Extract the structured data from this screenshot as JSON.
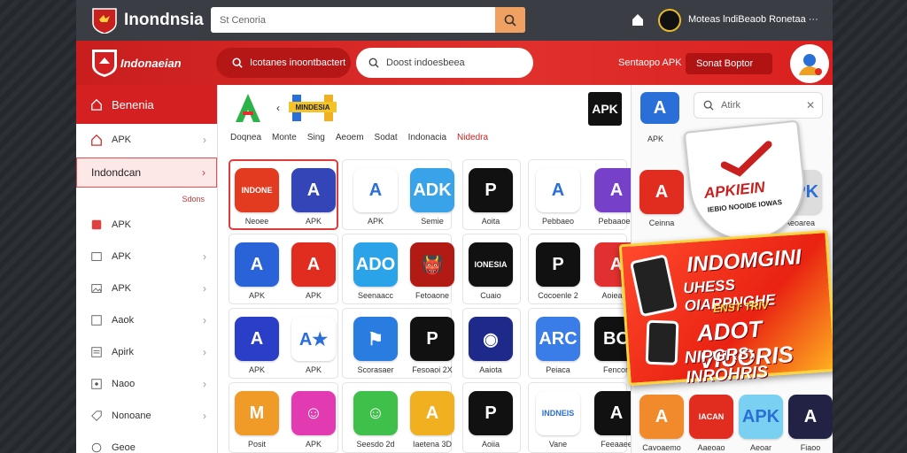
{
  "top": {
    "brand": "Inondnsia",
    "search_placeholder": "St Cenoria",
    "user_text": "Moteas lndiBeaob Ronetaa ···"
  },
  "redbar": {
    "brand": "Indonaeian",
    "pill1": "Icotanes inoontbactert",
    "pill2": "Doost indoesbeea",
    "link1": "Sentaopo APK",
    "link2": "Sonat Boptor"
  },
  "sidebar": {
    "head": "Benenia",
    "items": [
      {
        "label": "APK",
        "icon": "home-icon"
      },
      {
        "label": "Indondcan",
        "selected": true
      },
      {
        "tag": "Sdons"
      },
      {
        "label": "APK",
        "icon": "app-icon"
      },
      {
        "label": "APK",
        "icon": "image-icon"
      },
      {
        "label": "APK",
        "icon": "gallery-icon"
      },
      {
        "label": "Aaok",
        "icon": "square-icon"
      },
      {
        "label": "Apirk",
        "icon": "list-icon"
      },
      {
        "label": "Naoo",
        "icon": "grid-icon"
      },
      {
        "label": "Nonoane",
        "icon": "tag-icon"
      },
      {
        "label": "Geoe",
        "icon": "circle-icon"
      }
    ]
  },
  "categories": [
    "Doqnea",
    "Monte",
    "Sing",
    "Aeoem",
    "Sodat",
    "Indonacia",
    "Nidedra"
  ],
  "apps": {
    "row1": [
      {
        "icon_text": "INDONE",
        "label": "Neoee",
        "color": "#e33b20"
      },
      {
        "icon_text": "A",
        "label": "APK",
        "color": "#3445b8"
      },
      {
        "icon_text": "A",
        "label": "APK",
        "color": "#ffffff"
      },
      {
        "icon_text": "ADK",
        "label": "Semie",
        "color": "#38a3e8"
      },
      {
        "icon_text": "P",
        "label": "Aoita",
        "color": "#111111"
      },
      {
        "icon_text": "A",
        "label": "Pebbaeo",
        "color": "#ffffff"
      },
      {
        "icon_text": "A",
        "label": "Pebaaoee",
        "color": "#7740c8"
      }
    ],
    "row2": [
      {
        "icon_text": "A",
        "label": "APK",
        "color": "#2a63d8"
      },
      {
        "icon_text": "A",
        "label": "APK",
        "color": "#e12c20"
      },
      {
        "icon_text": "ADO",
        "label": "Seenaacc",
        "color": "#2aa3e8"
      },
      {
        "icon_text": "👹",
        "label": "Fetoaone",
        "color": "#b21a14"
      },
      {
        "icon_text": "IONESIA",
        "label": "Cuaio",
        "color": "#111111"
      },
      {
        "icon_text": "P",
        "label": "Cocoenle 2",
        "color": "#111111"
      },
      {
        "icon_text": "A",
        "label": "Aoieaee",
        "color": "#e23030"
      }
    ],
    "row3": [
      {
        "icon_text": "A",
        "label": "APK",
        "color": "#2b3ec8"
      },
      {
        "icon_text": "A★",
        "label": "APK",
        "color": "#ffffff"
      },
      {
        "icon_text": "⚑",
        "label": "Scorasaer",
        "color": "#2a7de0"
      },
      {
        "icon_text": "P",
        "label": "Fesoaoi 2X",
        "color": "#111111"
      },
      {
        "icon_text": "◉",
        "label": "Aaiota",
        "color": "#1d2a8a"
      },
      {
        "icon_text": "ARC",
        "label": "Peiaca",
        "color": "#3a7ce8"
      },
      {
        "icon_text": "BO",
        "label": "Fencon",
        "color": "#111111"
      }
    ],
    "row4": [
      {
        "icon_text": "M",
        "label": "Posit",
        "color": "#f09a28"
      },
      {
        "icon_text": "☺",
        "label": "APK",
        "color": "#e23ab0"
      },
      {
        "icon_text": "☺",
        "label": "Seesdo 2d",
        "color": "#3ec04a"
      },
      {
        "icon_text": "A",
        "label": "Iaetena 3D",
        "color": "#f0b020"
      },
      {
        "icon_text": "P",
        "label": "Aoiia",
        "color": "#111111"
      },
      {
        "icon_text": "INDNEIS",
        "label": "Vane",
        "color": "#ffffff"
      },
      {
        "icon_text": "A",
        "label": "Feeaaee",
        "color": "#111111"
      }
    ]
  },
  "right": {
    "search_placeholder": "Atirk",
    "top_label": "APK",
    "shield_title": "APKIEIN",
    "shield_sub": "IEBIO NOOIDE IOWAS",
    "row1": [
      {
        "icon_text": "A",
        "label": "Ceinna",
        "color": "#e12c20"
      },
      {
        "icon_text": "APK",
        "label": "Aeoarea",
        "color": "#dddddd"
      }
    ],
    "row2": [
      {
        "icon_text": "A",
        "label": "Cavoaemo",
        "color": "#f08a2a"
      },
      {
        "icon_text": "IACAN",
        "label": "Aaeoao",
        "color": "#e12c20"
      },
      {
        "icon_text": "APK",
        "label": "Aeoar",
        "color": "#7ad0f0"
      },
      {
        "icon_text": "A",
        "label": "Fiaoo",
        "color": "#222244"
      }
    ],
    "promo": {
      "l1": "INDOMGINI",
      "l2": "UHESS OIARPNGHE",
      "l3": "ENST TRIV",
      "l4": "ADOT VIUORIS",
      "l5": "NIPGRS: INROHRIS"
    }
  },
  "badge": {
    "apk": "APK"
  }
}
